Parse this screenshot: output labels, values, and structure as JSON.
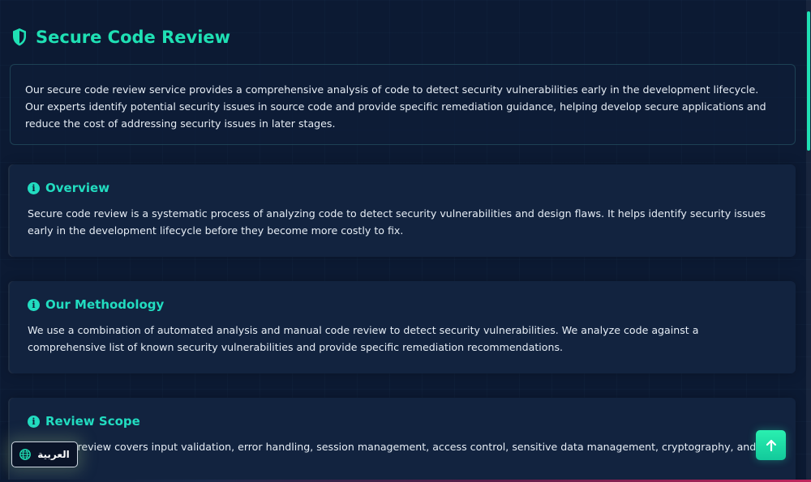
{
  "page": {
    "title": "Secure Code Review",
    "intro": "Our secure code review service provides a comprehensive analysis of code to detect security vulnerabilities early in the development lifecycle. Our experts identify potential security issues in source code and provide specific remediation guidance, helping develop secure applications and reduce the cost of addressing security issues in later stages."
  },
  "sections": [
    {
      "title": "Overview",
      "text": "Secure code review is a systematic process of analyzing code to detect security vulnerabilities and design flaws. It helps identify security issues early in the development lifecycle before they become more costly to fix."
    },
    {
      "title": "Our Methodology",
      "text": "We use a combination of automated analysis and manual code review to detect security vulnerabilities. We analyze code against a comprehensive list of known security vulnerabilities and provide specific remediation recommendations."
    },
    {
      "title": "Review Scope",
      "text": "Our code review covers input validation, error handling, session management, access control, sensitive data management, cryptography, and security configuration."
    }
  ],
  "controls": {
    "language_label": "العربية",
    "language_icon": "globe-icon",
    "scroll_top_icon": "arrow-up-icon"
  },
  "colors": {
    "accent": "#1fe0b4",
    "background": "#0c1a33",
    "card": "#12233f"
  }
}
